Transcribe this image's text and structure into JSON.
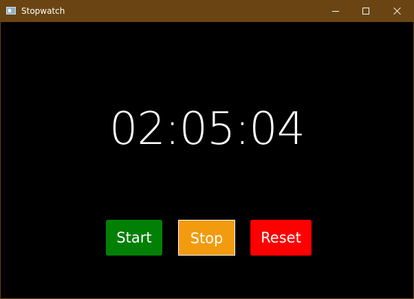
{
  "window": {
    "title": "Stopwatch",
    "icon": "stopwatch-window-icon",
    "controls": {
      "minimize": "minimize-icon",
      "maximize": "maximize-icon",
      "close": "close-icon"
    },
    "colors": {
      "title_bar": "#6a4513",
      "content_background": "#000000"
    }
  },
  "stopwatch": {
    "time": "02:05:04"
  },
  "buttons": {
    "start": {
      "label": "Start",
      "color": "#028006"
    },
    "stop": {
      "label": "Stop",
      "color": "#f39b0f"
    },
    "reset": {
      "label": "Reset",
      "color": "#ff0000"
    }
  }
}
